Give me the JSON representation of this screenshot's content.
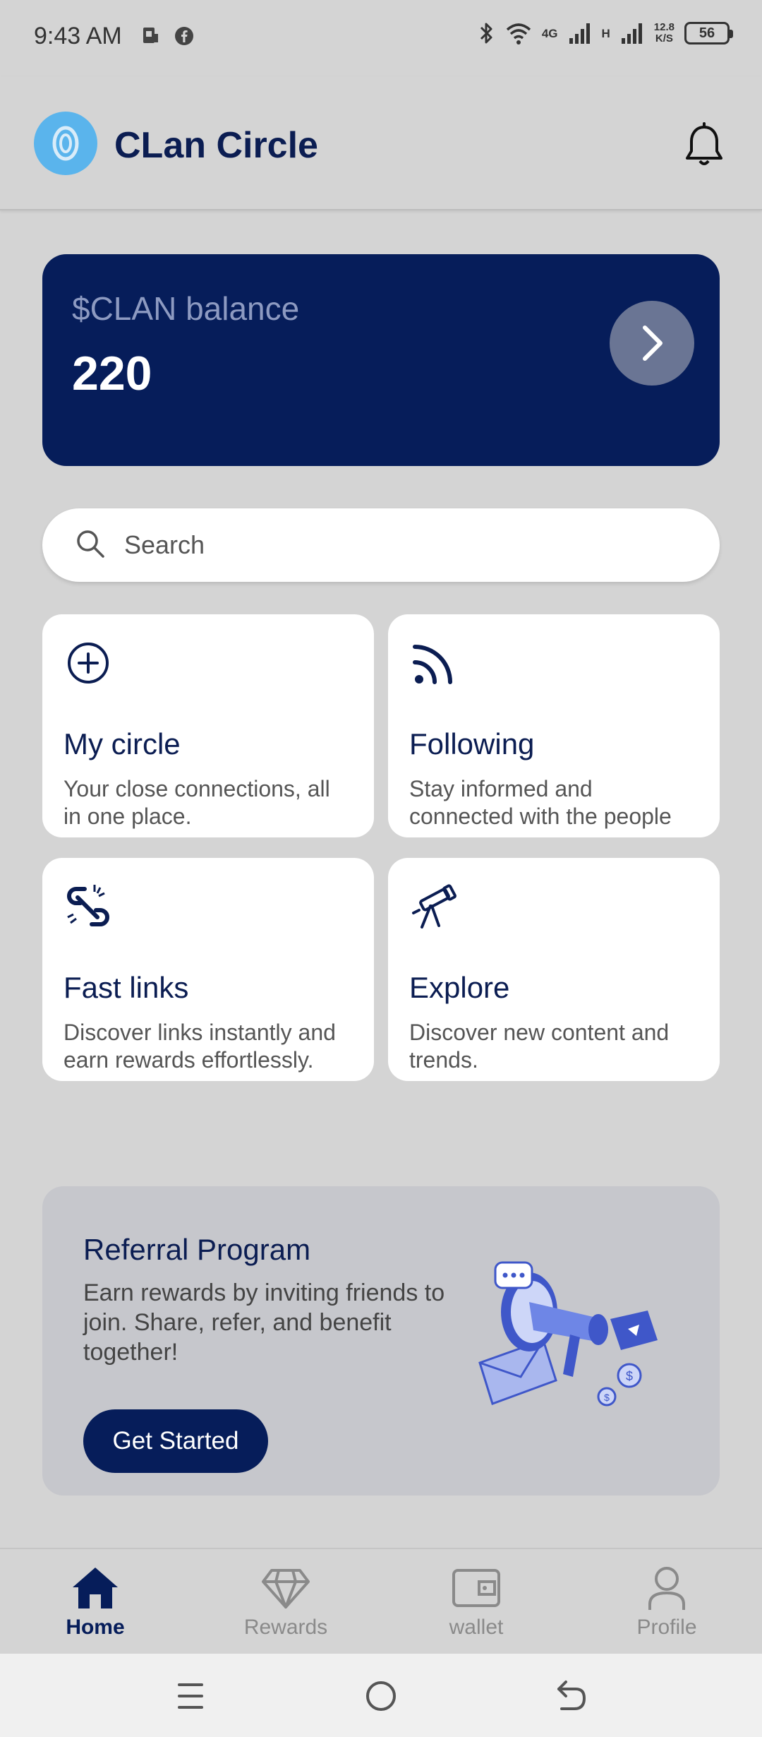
{
  "status_bar": {
    "time": "9:43 AM",
    "net_left": "4G",
    "net_right": "H",
    "speed_value": "12.8",
    "speed_unit": "K/S",
    "battery": "56"
  },
  "header": {
    "title": "CLan Circle"
  },
  "balance": {
    "label": "$CLAN balance",
    "value": "220"
  },
  "search": {
    "placeholder": "Search"
  },
  "tiles": [
    {
      "title": "My circle",
      "desc": "Your close connections, all in one place.",
      "icon": "plus-circle-icon"
    },
    {
      "title": "Following",
      "desc": "Stay informed and connected with the people",
      "icon": "rss-icon"
    },
    {
      "title": "Fast links",
      "desc": "Discover links instantly and earn rewards effortlessly.",
      "icon": "broken-link-icon"
    },
    {
      "title": "Explore",
      "desc": "Discover new content and trends.",
      "icon": "telescope-icon"
    }
  ],
  "referral": {
    "title": "Referral Program",
    "desc": "Earn rewards by inviting friends to join. Share, refer, and benefit together!",
    "button": "Get Started"
  },
  "bottom_nav": [
    {
      "label": "Home",
      "icon": "home-icon",
      "active": true
    },
    {
      "label": "Rewards",
      "icon": "diamond-icon",
      "active": false
    },
    {
      "label": "wallet",
      "icon": "wallet-icon",
      "active": false
    },
    {
      "label": "Profile",
      "icon": "user-icon",
      "active": false
    }
  ],
  "colors": {
    "primary": "#061d5a",
    "background": "#d4d4d4",
    "logo": "#5ab4ec",
    "inactive_nav": "#8a8a8a"
  }
}
